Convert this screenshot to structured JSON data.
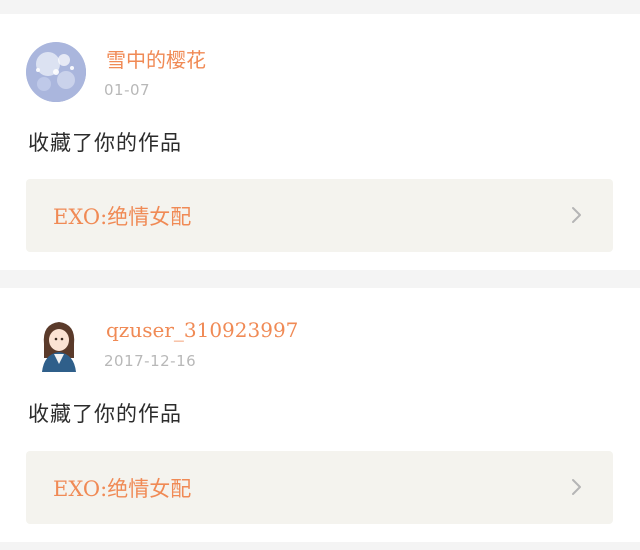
{
  "feed": [
    {
      "username": "雪中的樱花",
      "date": "01-07",
      "action": "收藏了你的作品",
      "work_title": "EXO:绝情女配"
    },
    {
      "username": "qzuser_310923997",
      "date": "2017-12-16",
      "action": "收藏了你的作品",
      "work_title": "EXO:绝情女配"
    }
  ],
  "icons": {
    "chevron": "chevron-right-icon"
  },
  "colors": {
    "accent": "#f08a55",
    "date": "#b8b8b8",
    "box_bg": "#f4f3ee",
    "page_bg": "#f4f4f4"
  }
}
